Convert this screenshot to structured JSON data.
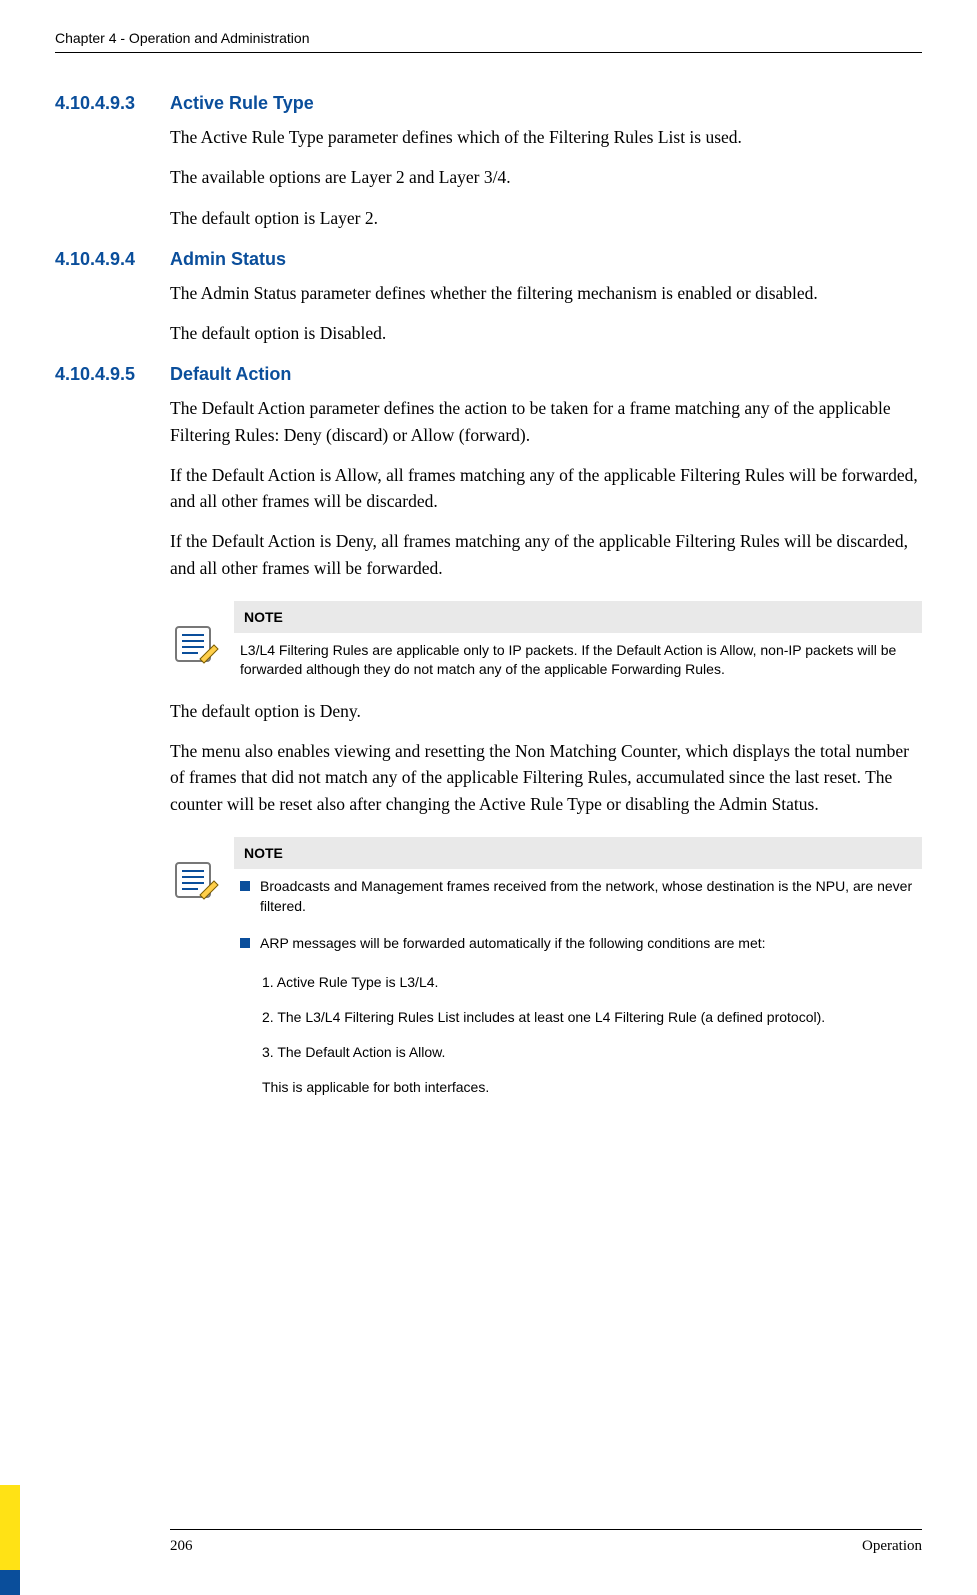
{
  "header": "Chapter 4 - Operation and Administration",
  "s1": {
    "num": "4.10.4.9.3",
    "title": "Active Rule Type",
    "p1": "The Active Rule Type parameter defines which of the Filtering Rules List is used.",
    "p2": "The available options are Layer 2 and Layer 3/4.",
    "p3": "The default option is Layer 2."
  },
  "s2": {
    "num": "4.10.4.9.4",
    "title": "Admin Status",
    "p1": "The Admin Status parameter defines whether the filtering mechanism is enabled or disabled.",
    "p2": "The default option is Disabled."
  },
  "s3": {
    "num": "4.10.4.9.5",
    "title": "Default Action",
    "p1": "The Default Action parameter defines the action to be taken for a frame matching any of the applicable Filtering Rules: Deny (discard) or Allow (forward).",
    "p2": "If the Default Action is Allow, all frames matching any of the applicable Filtering Rules will be forwarded, and all other frames will be discarded.",
    "p3": "If the Default Action is Deny, all frames matching any of the applicable Filtering Rules will be discarded, and all other frames will be forwarded.",
    "note1_head": "NOTE",
    "note1_body": "L3/L4 Filtering Rules are applicable only to IP packets. If the Default Action is Allow, non-IP packets will be forwarded although they do not match any of the applicable Forwarding Rules.",
    "p4": "The default option is Deny.",
    "p5": "The menu also enables viewing and resetting the Non Matching Counter, which displays the total number of frames that did not match any of the applicable Filtering Rules, accumulated since the last reset. The counter will be reset also after changing the Active Rule Type or disabling the Admin Status.",
    "note2_head": "NOTE",
    "note2_b1": "Broadcasts and Management frames received from the network, whose destination is the NPU, are never filtered.",
    "note2_b2": "ARP messages will be forwarded automatically if the following conditions are met:",
    "note2_s1": "1. Active Rule Type is L3/L4.",
    "note2_s2": "2.  The L3/L4 Filtering Rules List includes at least one L4 Filtering Rule (a defined protocol).",
    "note2_s3": "3. The Default Action is Allow.",
    "note2_s4": "This is applicable for both interfaces."
  },
  "footer": {
    "page": "206",
    "label": "Operation"
  }
}
